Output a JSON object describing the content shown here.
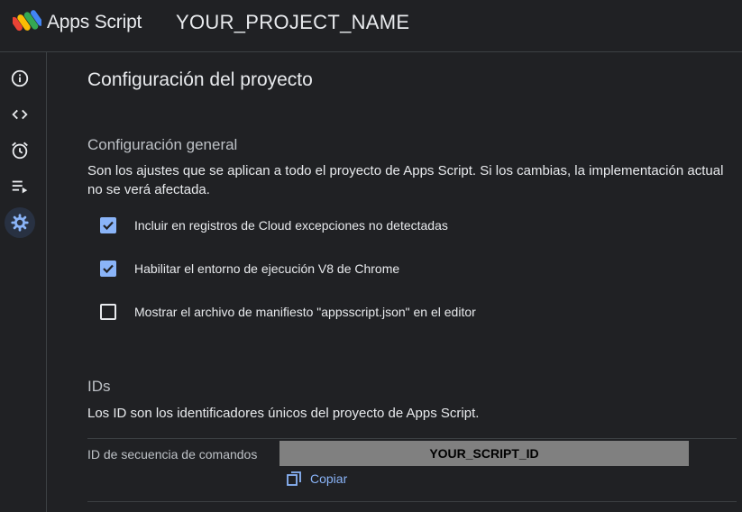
{
  "header": {
    "app_name": "Apps Script",
    "project_name": "YOUR_PROJECT_NAME"
  },
  "sidebar": {
    "items": [
      {
        "icon": "info-icon",
        "active": false
      },
      {
        "icon": "code-icon",
        "active": false
      },
      {
        "icon": "alarm-icon",
        "active": false
      },
      {
        "icon": "executions-icon",
        "active": false
      },
      {
        "icon": "gear-icon",
        "active": true
      }
    ]
  },
  "main": {
    "title": "Configuración del proyecto",
    "general": {
      "heading": "Configuración general",
      "description": "Son los ajustes que se aplican a todo el proyecto de Apps Script. Si los cambias, la implementación actual no se verá afectada.",
      "options": [
        {
          "label": "Incluir en registros de Cloud excepciones no detectadas",
          "checked": true
        },
        {
          "label": "Habilitar el entorno de ejecución V8 de Chrome",
          "checked": true
        },
        {
          "label": "Mostrar el archivo de manifiesto \"appsscript.json\" en el editor",
          "checked": false
        }
      ]
    },
    "ids": {
      "heading": "IDs",
      "description": "Los ID son los identificadores únicos del proyecto de Apps Script.",
      "script_id_label": "ID de secuencia de comandos",
      "script_id_value": "YOUR_SCRIPT_ID",
      "copy_label": "Copiar"
    }
  },
  "colors": {
    "background": "#202124",
    "accent": "#8ab4f8",
    "text": "#e8eaed",
    "divider": "#3c4043"
  }
}
